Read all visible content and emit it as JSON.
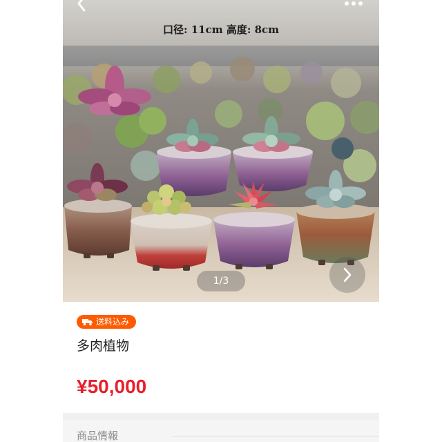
{
  "gallery": {
    "caption": "口径: 11cm 高度: 8cm",
    "counter": "1/3",
    "back_icon": "chevron-left-icon",
    "more_icon": "more-dots-icon",
    "next_icon": "chevron-right-icon"
  },
  "product": {
    "shipping_badge": "送料込み",
    "shipping_icon": "truck-icon",
    "title": "多肉植物",
    "price": "¥50,000"
  },
  "section": {
    "title": "商品情報"
  },
  "colors": {
    "accent": "#ff5a00",
    "price": "#e8202c"
  }
}
